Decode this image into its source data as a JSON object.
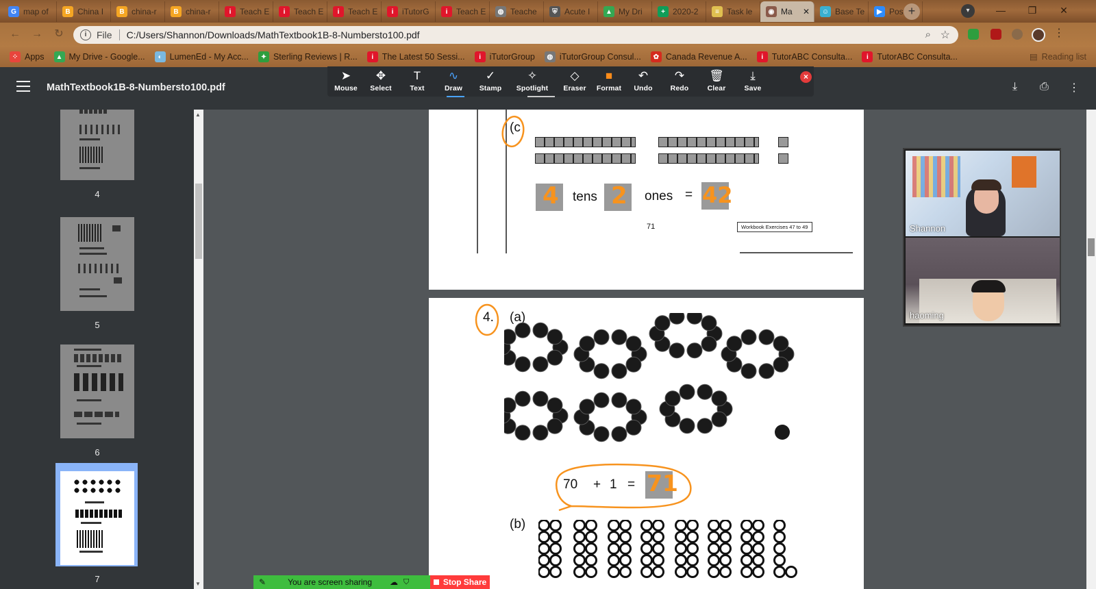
{
  "tabs": [
    {
      "label": "map of",
      "icon": "google-icon",
      "color": "#4285f4"
    },
    {
      "label": "China I",
      "icon": "shield-icon",
      "color": "#f5a623"
    },
    {
      "label": "china-r",
      "icon": "shield-icon",
      "color": "#f5a623"
    },
    {
      "label": "china-r",
      "icon": "shield-icon",
      "color": "#f5a623"
    },
    {
      "label": "Teach E",
      "icon": "itutor-icon",
      "color": "#e0162b"
    },
    {
      "label": "Teach E",
      "icon": "itutor-icon",
      "color": "#e0162b"
    },
    {
      "label": "Teach E",
      "icon": "itutor-icon",
      "color": "#e0162b"
    },
    {
      "label": "iTutorG",
      "icon": "itutor-icon",
      "color": "#e0162b"
    },
    {
      "label": "Teach E",
      "icon": "itutor-icon",
      "color": "#e0162b"
    },
    {
      "label": "Teache",
      "icon": "globe-icon",
      "color": "#777777"
    },
    {
      "label": "Acute I",
      "icon": "crest-icon",
      "color": "#555555"
    },
    {
      "label": "My Dri",
      "icon": "drive-icon",
      "color": "#34a853"
    },
    {
      "label": "2020-2",
      "icon": "sheets-icon",
      "color": "#0f9d58"
    },
    {
      "label": "Task le",
      "icon": "doc-icon",
      "color": "#e0c050"
    },
    {
      "label": "Ma",
      "icon": "pdf-icon",
      "color": "#8a5a4a",
      "active": true
    },
    {
      "label": "Base Te",
      "icon": "robot-icon",
      "color": "#3ab0d0"
    },
    {
      "label": "Post At",
      "icon": "zoom-icon",
      "color": "#2d8cff"
    }
  ],
  "window": {
    "minimize": "—",
    "restore": "❐",
    "close": "✕"
  },
  "address": {
    "scheme_label": "File",
    "url": "C:/Users/Shannon/Downloads/MathTextbook1B-8-Numbersto100.pdf"
  },
  "bookmarks": [
    {
      "label": "Apps",
      "icon": "apps-grid-icon",
      "color": "#e8453c"
    },
    {
      "label": "My Drive - Google...",
      "icon": "drive-icon",
      "color": "#34a853"
    },
    {
      "label": "LumenEd - My Acc...",
      "icon": "lumened-icon",
      "color": "#7ab8e0"
    },
    {
      "label": "Sterling Reviews | R...",
      "icon": "star-leaf-icon",
      "color": "#2e9e3e"
    },
    {
      "label": "The Latest 50 Sessi...",
      "icon": "itutor-icon",
      "color": "#e0162b"
    },
    {
      "label": "iTutorGroup",
      "icon": "itutor-icon",
      "color": "#e0162b"
    },
    {
      "label": "iTutorGroup Consul...",
      "icon": "globe-icon",
      "color": "#777777"
    },
    {
      "label": "Canada Revenue A...",
      "icon": "maple-leaf-icon",
      "color": "#d52b1e"
    },
    {
      "label": "TutorABC Consulta...",
      "icon": "itutor-icon",
      "color": "#e0162b"
    },
    {
      "label": "TutorABC Consulta...",
      "icon": "itutor-icon",
      "color": "#e0162b"
    }
  ],
  "reading_list": "Reading list",
  "pdf": {
    "title": "MathTextbook1B-8-Numbersto100.pdf"
  },
  "annotation_tools": [
    {
      "label": "Mouse",
      "icon": "cursor-icon"
    },
    {
      "label": "Select",
      "icon": "move-icon"
    },
    {
      "label": "Text",
      "icon": "text-icon"
    },
    {
      "label": "Draw",
      "icon": "draw-wave-icon"
    },
    {
      "label": "Stamp",
      "icon": "checkmark-icon"
    },
    {
      "label": "Spotlight",
      "icon": "wand-icon"
    },
    {
      "label": "Eraser",
      "icon": "eraser-icon"
    },
    {
      "label": "Format",
      "icon": "format-swatch-icon"
    },
    {
      "label": "Undo",
      "icon": "undo-icon"
    },
    {
      "label": "Redo",
      "icon": "redo-icon"
    },
    {
      "label": "Clear",
      "icon": "trash-icon"
    },
    {
      "label": "Save",
      "icon": "save-icon"
    }
  ],
  "thumbnails": [
    {
      "page": "4"
    },
    {
      "page": "5"
    },
    {
      "page": "6"
    },
    {
      "page": "7",
      "selected": true
    }
  ],
  "page_top": {
    "part_label": "(c",
    "tens_word": "tens",
    "ones_word": "ones",
    "equals": "=",
    "tens_answer": "4",
    "ones_answer": "2",
    "total_answer": "42",
    "page_number": "71",
    "workbook_ref": "Workbook Exercises 47 to 49"
  },
  "page_bottom": {
    "question_number": "4.",
    "part_a": "(a)",
    "equation": {
      "a": "70",
      "plus": "+",
      "b": "1",
      "eq": "="
    },
    "answer": "71",
    "part_b": "(b)"
  },
  "video": {
    "participants": [
      {
        "name": "Shannon"
      },
      {
        "name": "haoming"
      }
    ]
  },
  "share": {
    "status": "You are screen sharing",
    "stop": "Stop Share"
  },
  "colors": {
    "accent_orange": "#f7931e",
    "share_green": "#3ebd3e",
    "stop_red": "#ff3b3b"
  }
}
